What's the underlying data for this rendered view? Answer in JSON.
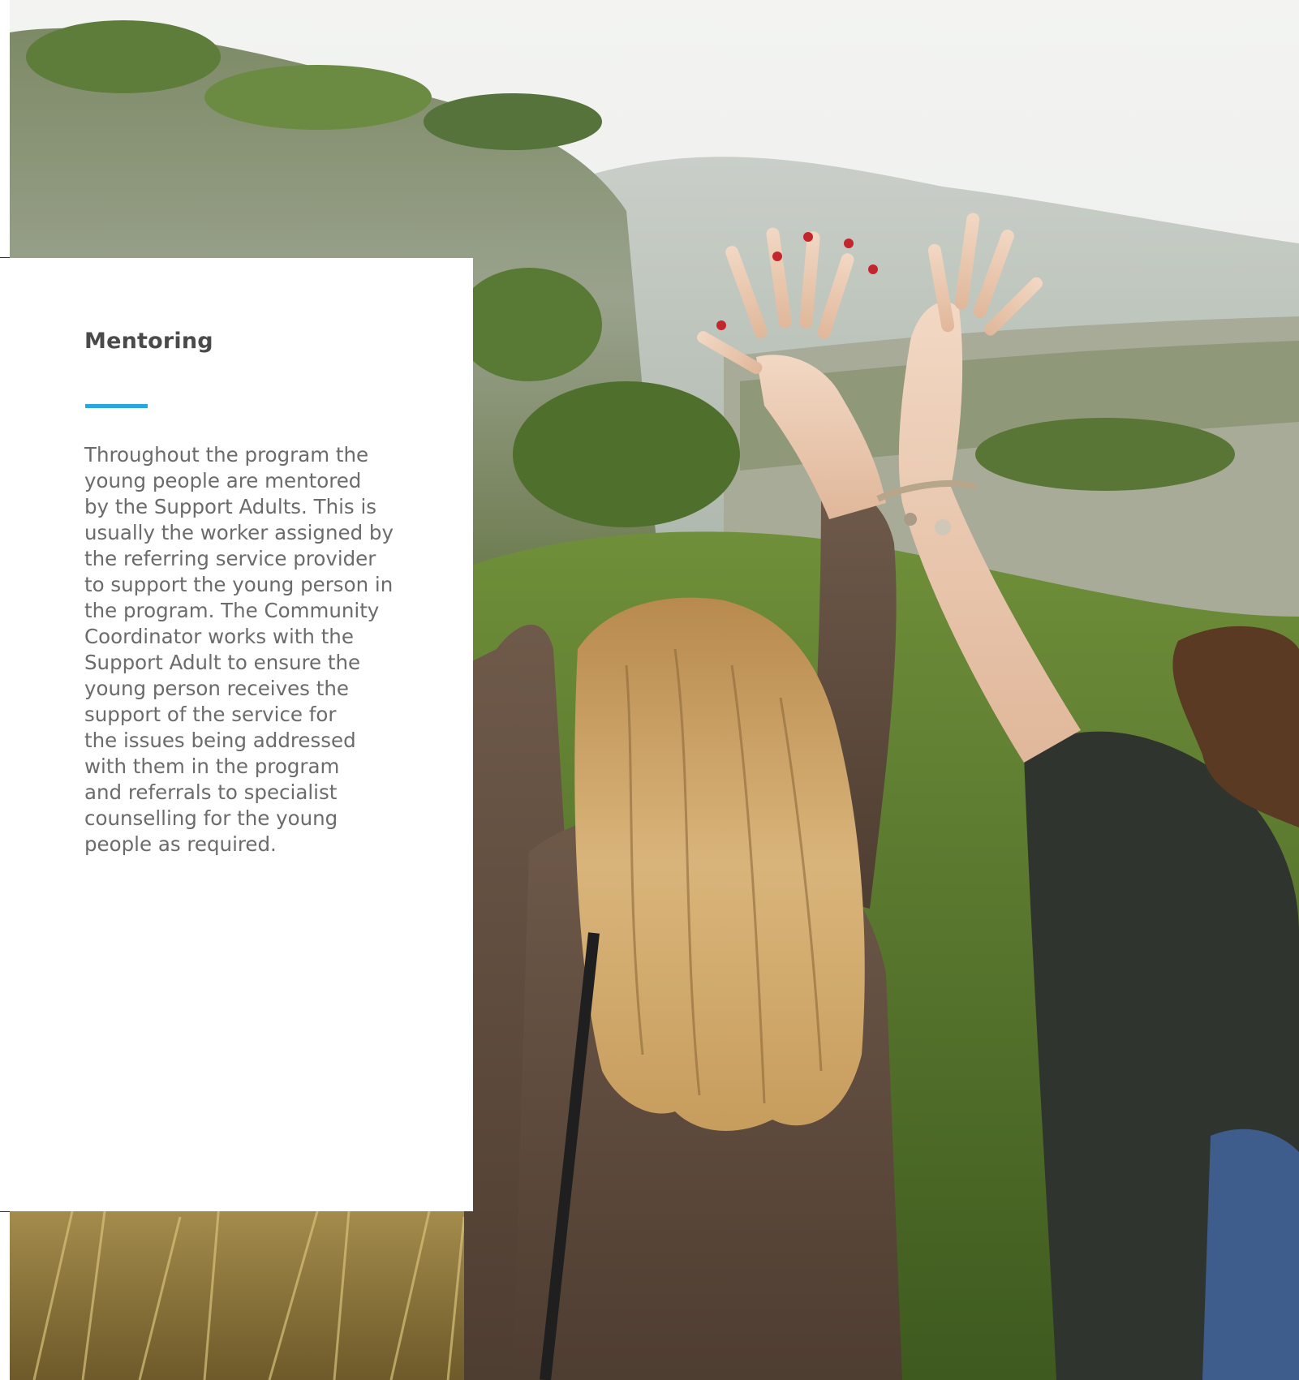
{
  "section": {
    "title": "Mentoring",
    "accent_color": "#29a8df",
    "body_lines": [
      "Throughout the program the",
      "young people are mentored",
      "by the Support Adults. This is",
      "usually the worker assigned by",
      "the referring service provider",
      "to support the young person in",
      "the program. The Community",
      "Coordinator works with the",
      "Support Adult to ensure the",
      "young person receives the",
      "support of the service for",
      "the issues being addressed",
      "with them in the program",
      "and referrals to specialist",
      "counselling for the young",
      "people as required."
    ]
  },
  "photo": {
    "subject": "two-young-women-raising-arms-outdoors"
  }
}
